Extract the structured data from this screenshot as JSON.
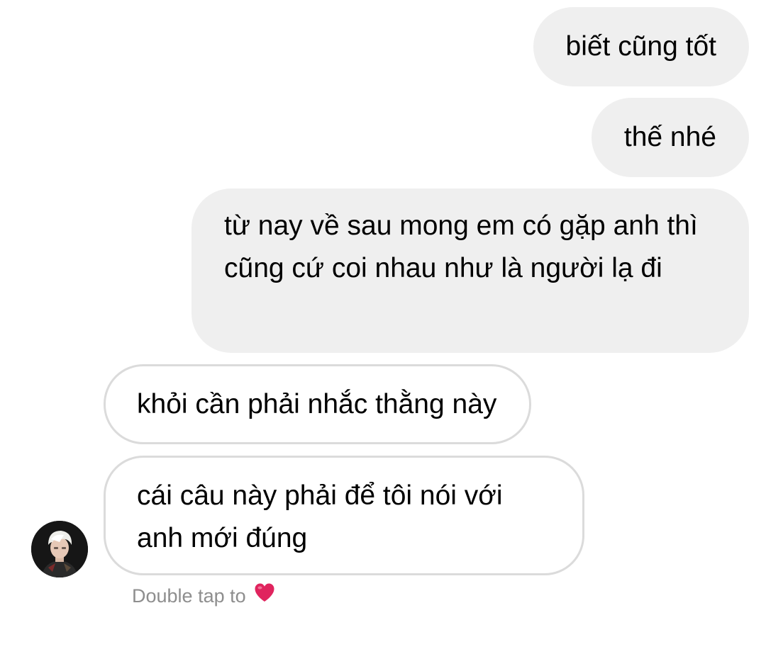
{
  "messages": [
    {
      "direction": "sent",
      "text": "biết cũng tốt"
    },
    {
      "direction": "sent",
      "text": "thế nhé"
    },
    {
      "direction": "sent",
      "text": "từ nay về sau mong em có gặp anh thì cũng cứ coi nhau như là người lạ đi"
    },
    {
      "direction": "received",
      "text": "khỏi cần phải nhắc thằng này"
    },
    {
      "direction": "received",
      "text": "cái câu này phải để tôi nói với anh mới đúng"
    }
  ],
  "reaction_hint": {
    "text": "Double tap to",
    "icon": "red-heart-icon"
  },
  "colors": {
    "sent_bubble": "#efefef",
    "received_border": "#dbdbdb",
    "hint_text": "#8e8e8e",
    "heart": "#e0245e"
  }
}
